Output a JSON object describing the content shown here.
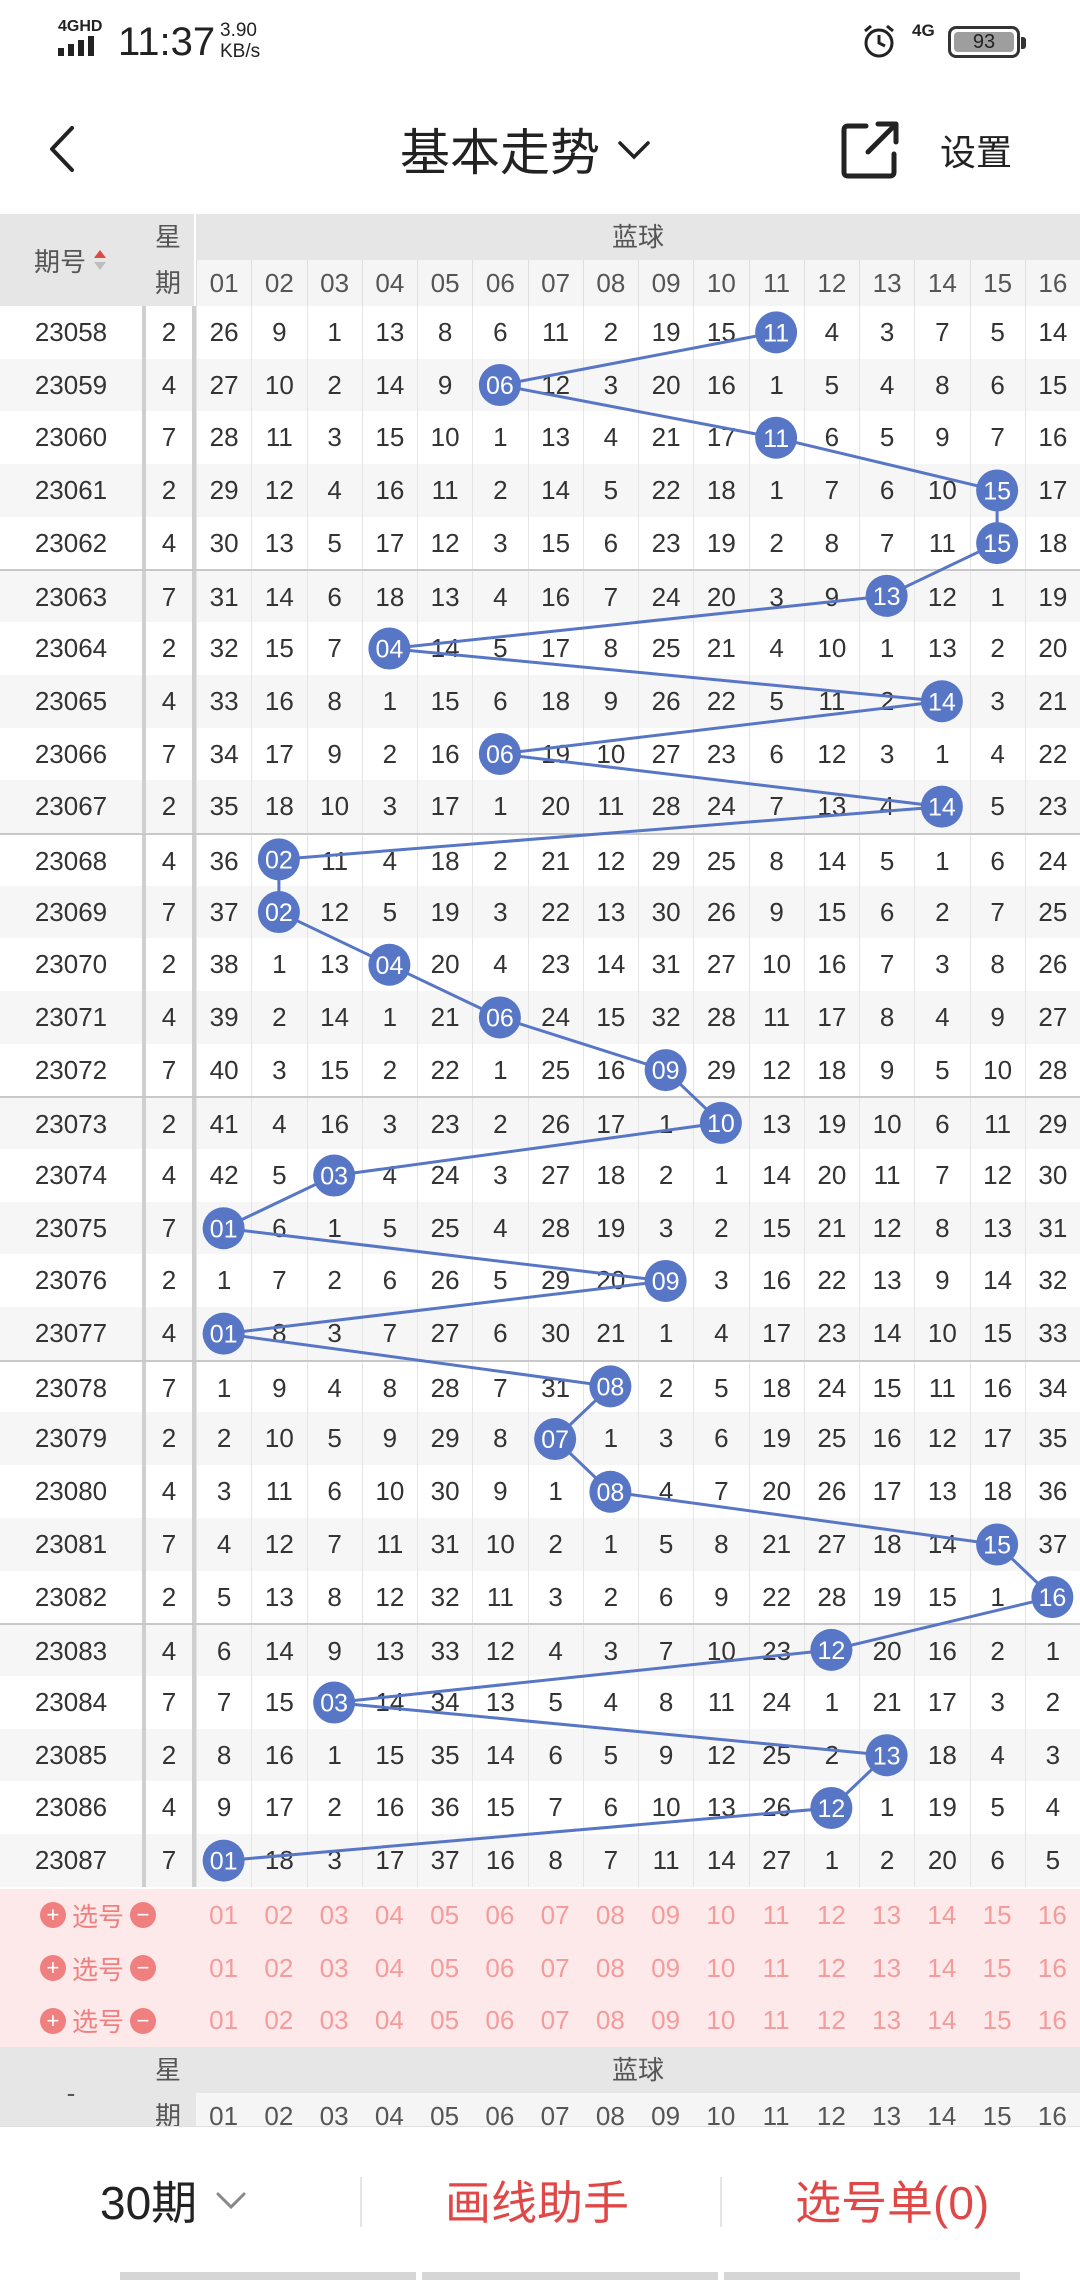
{
  "status_bar": {
    "network": "4GHD",
    "time": "11:37",
    "speed_value": "3.90",
    "speed_unit": "KB/s",
    "network_right": "4G",
    "battery": "93"
  },
  "header": {
    "title": "基本走势",
    "settings_label": "设置"
  },
  "table": {
    "period_header": "期号",
    "week_header_top": "星",
    "week_header_bottom": "期",
    "blue_header": "蓝球",
    "number_headers": [
      "01",
      "02",
      "03",
      "04",
      "05",
      "06",
      "07",
      "08",
      "09",
      "10",
      "11",
      "12",
      "13",
      "14",
      "15",
      "16"
    ],
    "highlight_color": "#5876c6",
    "rows": [
      {
        "period": "23058",
        "week": "2",
        "cells": [
          "26",
          "9",
          "1",
          "13",
          "8",
          "6",
          "11",
          "2",
          "19",
          "15",
          "11",
          "4",
          "3",
          "7",
          "5",
          "14"
        ],
        "hit": 11
      },
      {
        "period": "23059",
        "week": "4",
        "cells": [
          "27",
          "10",
          "2",
          "14",
          "9",
          "06",
          "12",
          "3",
          "20",
          "16",
          "1",
          "5",
          "4",
          "8",
          "6",
          "15"
        ],
        "hit": 6
      },
      {
        "period": "23060",
        "week": "7",
        "cells": [
          "28",
          "11",
          "3",
          "15",
          "10",
          "1",
          "13",
          "4",
          "21",
          "17",
          "11",
          "6",
          "5",
          "9",
          "7",
          "16"
        ],
        "hit": 11
      },
      {
        "period": "23061",
        "week": "2",
        "cells": [
          "29",
          "12",
          "4",
          "16",
          "11",
          "2",
          "14",
          "5",
          "22",
          "18",
          "1",
          "7",
          "6",
          "10",
          "15",
          "17"
        ],
        "hit": 15
      },
      {
        "period": "23062",
        "week": "4",
        "cells": [
          "30",
          "13",
          "5",
          "17",
          "12",
          "3",
          "15",
          "6",
          "23",
          "19",
          "2",
          "8",
          "7",
          "11",
          "15",
          "18"
        ],
        "hit": 15
      },
      {
        "period": "23063",
        "week": "7",
        "cells": [
          "31",
          "14",
          "6",
          "18",
          "13",
          "4",
          "16",
          "7",
          "24",
          "20",
          "3",
          "9",
          "13",
          "12",
          "1",
          "19"
        ],
        "hit": 13
      },
      {
        "period": "23064",
        "week": "2",
        "cells": [
          "32",
          "15",
          "7",
          "04",
          "14",
          "5",
          "17",
          "8",
          "25",
          "21",
          "4",
          "10",
          "1",
          "13",
          "2",
          "20"
        ],
        "hit": 4
      },
      {
        "period": "23065",
        "week": "4",
        "cells": [
          "33",
          "16",
          "8",
          "1",
          "15",
          "6",
          "18",
          "9",
          "26",
          "22",
          "5",
          "11",
          "2",
          "14",
          "3",
          "21"
        ],
        "hit": 14
      },
      {
        "period": "23066",
        "week": "7",
        "cells": [
          "34",
          "17",
          "9",
          "2",
          "16",
          "06",
          "19",
          "10",
          "27",
          "23",
          "6",
          "12",
          "3",
          "1",
          "4",
          "22"
        ],
        "hit": 6
      },
      {
        "period": "23067",
        "week": "2",
        "cells": [
          "35",
          "18",
          "10",
          "3",
          "17",
          "1",
          "20",
          "11",
          "28",
          "24",
          "7",
          "13",
          "4",
          "14",
          "5",
          "23"
        ],
        "hit": 14
      },
      {
        "period": "23068",
        "week": "4",
        "cells": [
          "36",
          "02",
          "11",
          "4",
          "18",
          "2",
          "21",
          "12",
          "29",
          "25",
          "8",
          "14",
          "5",
          "1",
          "6",
          "24"
        ],
        "hit": 2
      },
      {
        "period": "23069",
        "week": "7",
        "cells": [
          "37",
          "02",
          "12",
          "5",
          "19",
          "3",
          "22",
          "13",
          "30",
          "26",
          "9",
          "15",
          "6",
          "2",
          "7",
          "25"
        ],
        "hit": 2
      },
      {
        "period": "23070",
        "week": "2",
        "cells": [
          "38",
          "1",
          "13",
          "04",
          "20",
          "4",
          "23",
          "14",
          "31",
          "27",
          "10",
          "16",
          "7",
          "3",
          "8",
          "26"
        ],
        "hit": 4
      },
      {
        "period": "23071",
        "week": "4",
        "cells": [
          "39",
          "2",
          "14",
          "1",
          "21",
          "06",
          "24",
          "15",
          "32",
          "28",
          "11",
          "17",
          "8",
          "4",
          "9",
          "27"
        ],
        "hit": 6
      },
      {
        "period": "23072",
        "week": "7",
        "cells": [
          "40",
          "3",
          "15",
          "2",
          "22",
          "1",
          "25",
          "16",
          "09",
          "29",
          "12",
          "18",
          "9",
          "5",
          "10",
          "28"
        ],
        "hit": 9
      },
      {
        "period": "23073",
        "week": "2",
        "cells": [
          "41",
          "4",
          "16",
          "3",
          "23",
          "2",
          "26",
          "17",
          "1",
          "10",
          "13",
          "19",
          "10",
          "6",
          "11",
          "29"
        ],
        "hit": 10
      },
      {
        "period": "23074",
        "week": "4",
        "cells": [
          "42",
          "5",
          "03",
          "4",
          "24",
          "3",
          "27",
          "18",
          "2",
          "1",
          "14",
          "20",
          "11",
          "7",
          "12",
          "30"
        ],
        "hit": 3
      },
      {
        "period": "23075",
        "week": "7",
        "cells": [
          "01",
          "6",
          "1",
          "5",
          "25",
          "4",
          "28",
          "19",
          "3",
          "2",
          "15",
          "21",
          "12",
          "8",
          "13",
          "31"
        ],
        "hit": 1
      },
      {
        "period": "23076",
        "week": "2",
        "cells": [
          "1",
          "7",
          "2",
          "6",
          "26",
          "5",
          "29",
          "20",
          "09",
          "3",
          "16",
          "22",
          "13",
          "9",
          "14",
          "32"
        ],
        "hit": 9
      },
      {
        "period": "23077",
        "week": "4",
        "cells": [
          "01",
          "8",
          "3",
          "7",
          "27",
          "6",
          "30",
          "21",
          "1",
          "4",
          "17",
          "23",
          "14",
          "10",
          "15",
          "33"
        ],
        "hit": 1
      },
      {
        "period": "23078",
        "week": "7",
        "cells": [
          "1",
          "9",
          "4",
          "8",
          "28",
          "7",
          "31",
          "08",
          "2",
          "5",
          "18",
          "24",
          "15",
          "11",
          "16",
          "34"
        ],
        "hit": 8
      },
      {
        "period": "23079",
        "week": "2",
        "cells": [
          "2",
          "10",
          "5",
          "9",
          "29",
          "8",
          "07",
          "1",
          "3",
          "6",
          "19",
          "25",
          "16",
          "12",
          "17",
          "35"
        ],
        "hit": 7
      },
      {
        "period": "23080",
        "week": "4",
        "cells": [
          "3",
          "11",
          "6",
          "10",
          "30",
          "9",
          "1",
          "08",
          "4",
          "7",
          "20",
          "26",
          "17",
          "13",
          "18",
          "36"
        ],
        "hit": 8
      },
      {
        "period": "23081",
        "week": "7",
        "cells": [
          "4",
          "12",
          "7",
          "11",
          "31",
          "10",
          "2",
          "1",
          "5",
          "8",
          "21",
          "27",
          "18",
          "14",
          "15",
          "37"
        ],
        "hit": 15
      },
      {
        "period": "23082",
        "week": "2",
        "cells": [
          "5",
          "13",
          "8",
          "12",
          "32",
          "11",
          "3",
          "2",
          "6",
          "9",
          "22",
          "28",
          "19",
          "15",
          "1",
          "16"
        ],
        "hit": 16
      },
      {
        "period": "23083",
        "week": "4",
        "cells": [
          "6",
          "14",
          "9",
          "13",
          "33",
          "12",
          "4",
          "3",
          "7",
          "10",
          "23",
          "12",
          "20",
          "16",
          "2",
          "1"
        ],
        "hit": 12
      },
      {
        "period": "23084",
        "week": "7",
        "cells": [
          "7",
          "15",
          "03",
          "14",
          "34",
          "13",
          "5",
          "4",
          "8",
          "11",
          "24",
          "1",
          "21",
          "17",
          "3",
          "2"
        ],
        "hit": 3
      },
      {
        "period": "23085",
        "week": "2",
        "cells": [
          "8",
          "16",
          "1",
          "15",
          "35",
          "14",
          "6",
          "5",
          "9",
          "12",
          "25",
          "2",
          "13",
          "18",
          "4",
          "3"
        ],
        "hit": 13
      },
      {
        "period": "23086",
        "week": "4",
        "cells": [
          "9",
          "17",
          "2",
          "16",
          "36",
          "15",
          "7",
          "6",
          "10",
          "13",
          "26",
          "12",
          "1",
          "19",
          "5",
          "4"
        ],
        "hit": 12
      },
      {
        "period": "23087",
        "week": "7",
        "cells": [
          "01",
          "18",
          "3",
          "17",
          "37",
          "16",
          "8",
          "7",
          "11",
          "14",
          "27",
          "1",
          "2",
          "20",
          "6",
          "5"
        ],
        "hit": 1
      }
    ]
  },
  "pick_rows": [
    {
      "plus": "+",
      "label": "选号",
      "minus": "−"
    },
    {
      "plus": "+",
      "label": "选号",
      "minus": "−"
    },
    {
      "plus": "+",
      "label": "选号",
      "minus": "−"
    }
  ],
  "footer_header": {
    "dash": "-",
    "week_top": "星",
    "week_bottom": "期",
    "blue": "蓝球"
  },
  "bottom_bar": {
    "periods_label": "30期",
    "draw_helper_label": "画线助手",
    "pick_list_label": "选号单(0)"
  }
}
